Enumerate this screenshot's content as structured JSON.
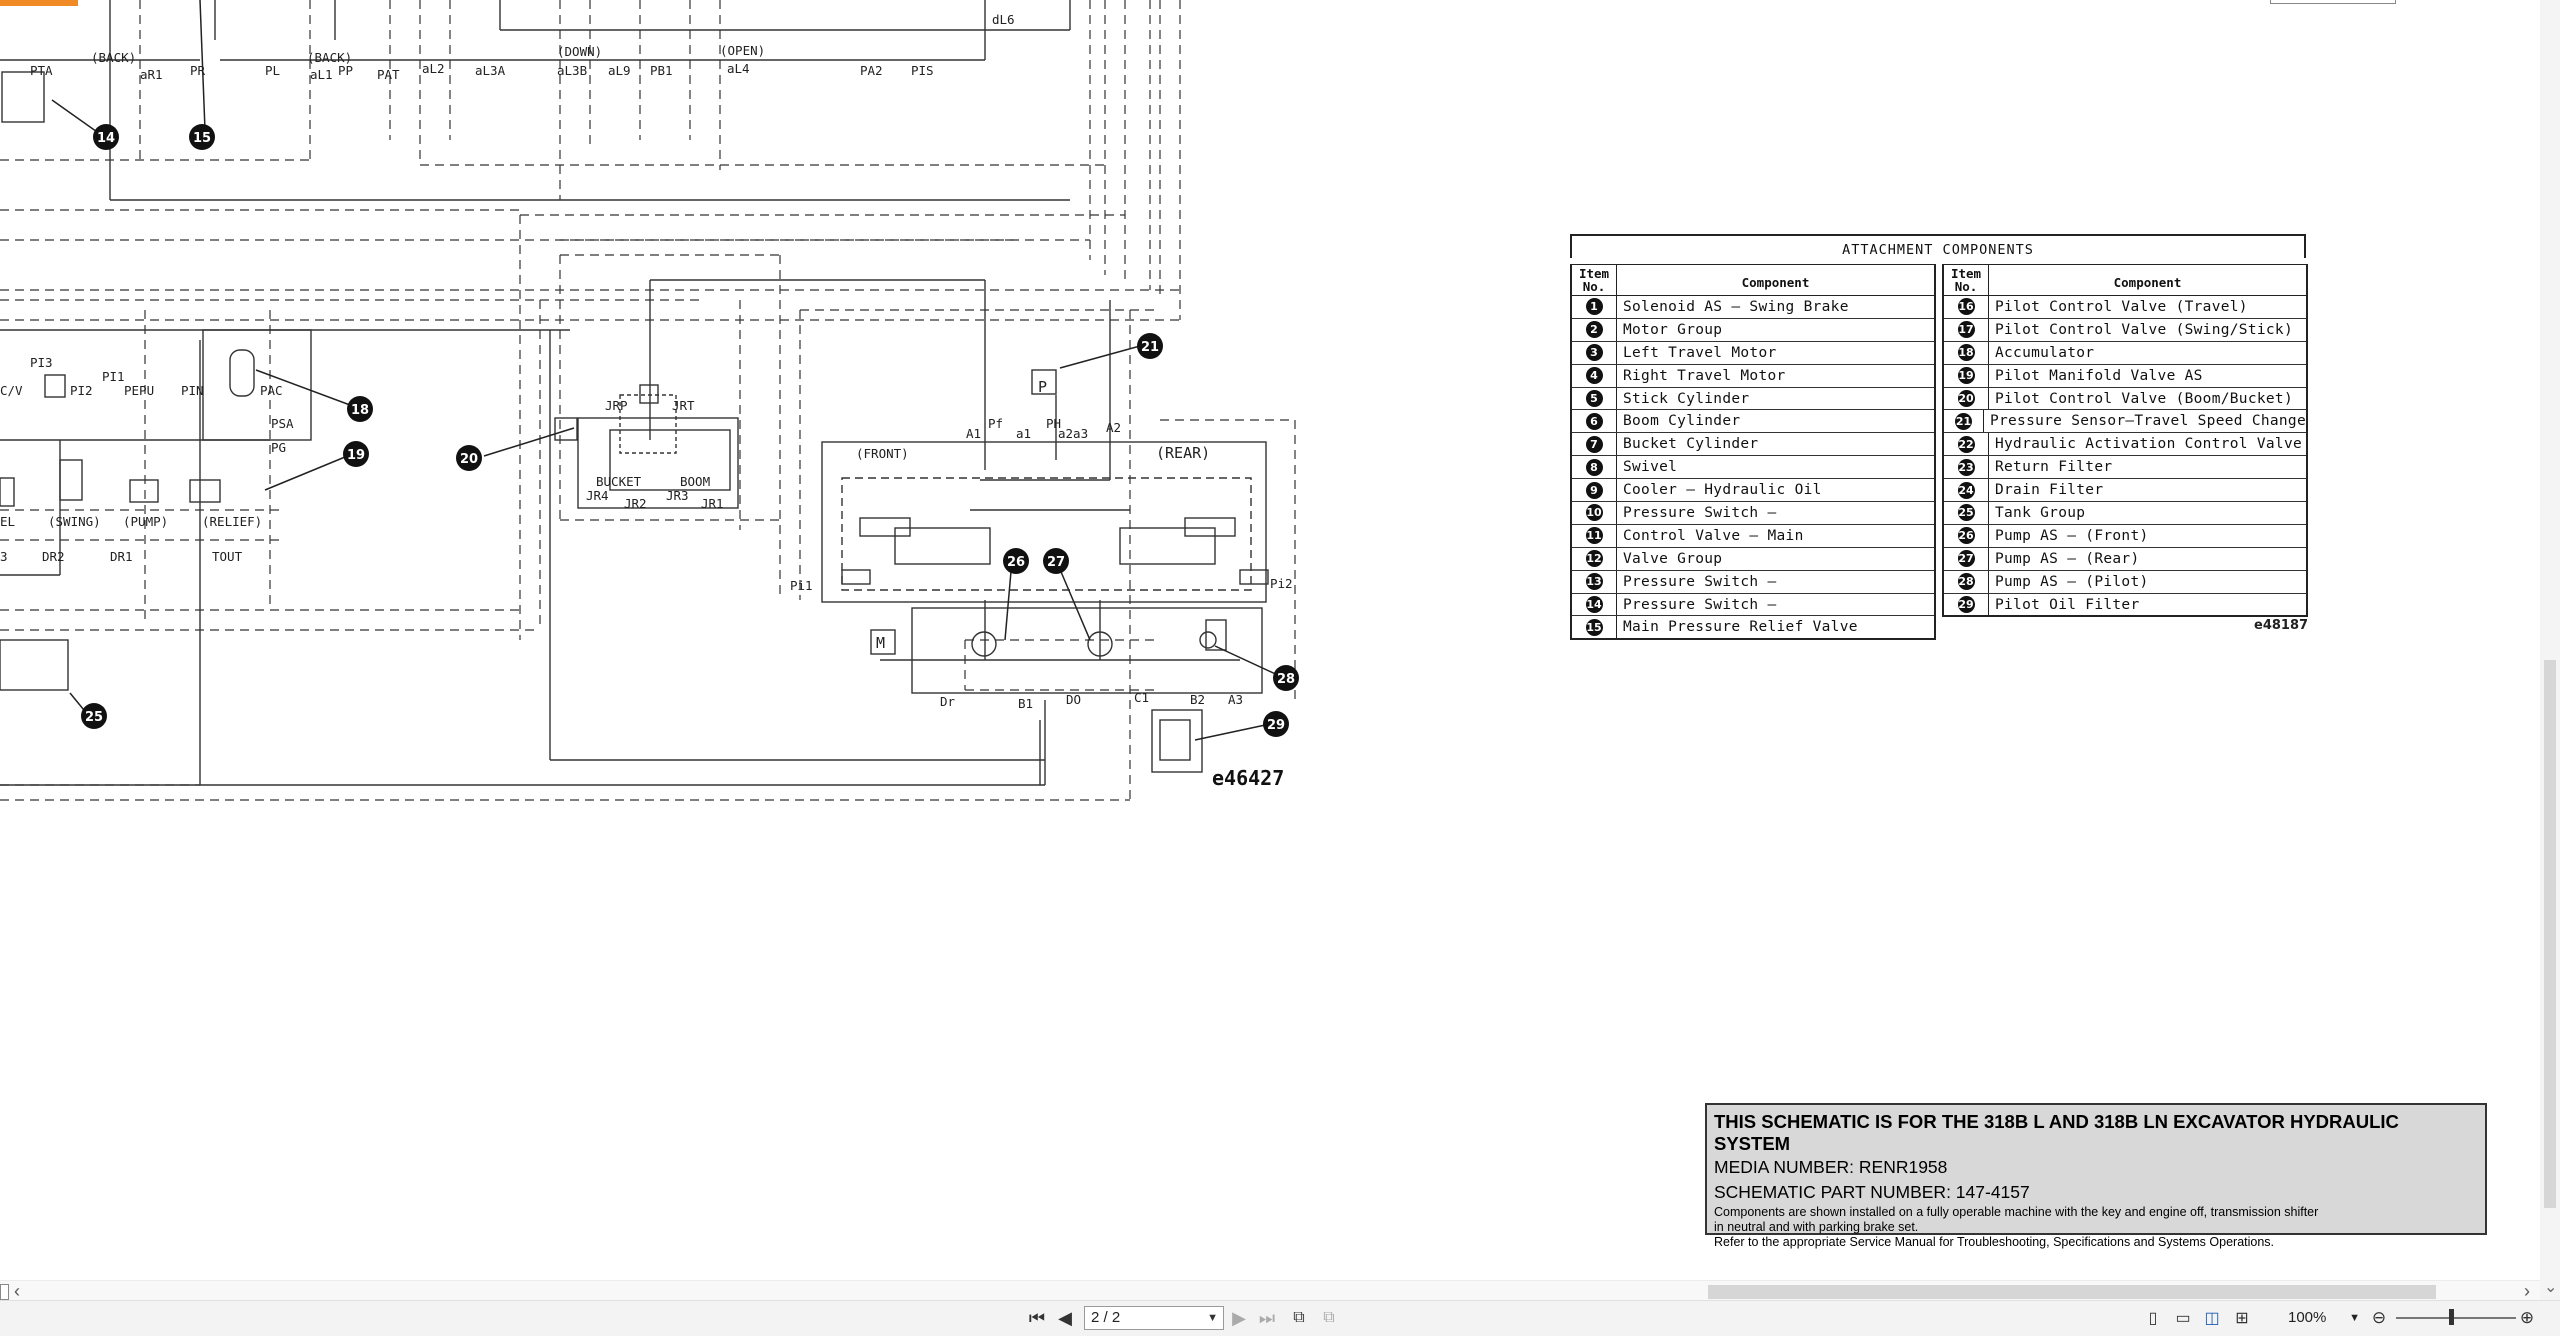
{
  "document": {
    "table_title": "ATTACHMENT  COMPONENTS",
    "header_item": [
      "Item",
      "No."
    ],
    "header_component": "Component",
    "left_items": [
      {
        "no": "1",
        "name": "Solenoid AS – Swing Brake"
      },
      {
        "no": "2",
        "name": "Motor Group"
      },
      {
        "no": "3",
        "name": "Left Travel Motor"
      },
      {
        "no": "4",
        "name": "Right Travel Motor"
      },
      {
        "no": "5",
        "name": "Stick Cylinder"
      },
      {
        "no": "6",
        "name": "Boom Cylinder"
      },
      {
        "no": "7",
        "name": "Bucket Cylinder"
      },
      {
        "no": "8",
        "name": "Swivel"
      },
      {
        "no": "9",
        "name": "Cooler – Hydraulic Oil"
      },
      {
        "no": "10",
        "name": "Pressure Switch –"
      },
      {
        "no": "11",
        "name": "Control Valve – Main"
      },
      {
        "no": "12",
        "name": "Valve Group"
      },
      {
        "no": "13",
        "name": "Pressure Switch –"
      },
      {
        "no": "14",
        "name": "Pressure Switch –"
      },
      {
        "no": "15",
        "name": "Main Pressure Relief Valve"
      }
    ],
    "right_items": [
      {
        "no": "16",
        "name": "Pilot Control Valve (Travel)"
      },
      {
        "no": "17",
        "name": "Pilot Control Valve (Swing/Stick)"
      },
      {
        "no": "18",
        "name": "Accumulator"
      },
      {
        "no": "19",
        "name": "Pilot Manifold Valve AS"
      },
      {
        "no": "20",
        "name": "Pilot Control Valve (Boom/Bucket)"
      },
      {
        "no": "21",
        "name": "Pressure Sensor–Travel Speed Change"
      },
      {
        "no": "22",
        "name": "Hydraulic Activation Control Valve"
      },
      {
        "no": "23",
        "name": "Return Filter"
      },
      {
        "no": "24",
        "name": "Drain Filter"
      },
      {
        "no": "25",
        "name": "Tank Group"
      },
      {
        "no": "26",
        "name": "Pump AS – (Front)"
      },
      {
        "no": "27",
        "name": "Pump AS – (Rear)"
      },
      {
        "no": "28",
        "name": "Pump AS – (Pilot)"
      },
      {
        "no": "29",
        "name": "Pilot Oil Filter"
      }
    ],
    "table_ref": "e48187",
    "schematic_ref": "e46427",
    "notice": {
      "title": "THIS SCHEMATIC IS FOR THE 318B L AND 318B LN EXCAVATOR HYDRAULIC SYSTEM",
      "media": "MEDIA NUMBER: RENR1958",
      "part": "SCHEMATIC PART NUMBER: 147-4157",
      "line1": "Components are shown installed on a fully operable machine with the key and engine off, transmission shifter",
      "line2": "in neutral and with parking brake set.",
      "line3": "Refer to the appropriate Service Manual for Troubleshooting, Specifications and Systems Operations."
    },
    "schematic_labels": {
      "front": "(FRONT)",
      "rear": "(REAR)",
      "back1": "(BACK)",
      "back2": "(BACK)",
      "down": "(DOWN)",
      "open": "(OPEN)",
      "swing": "(SWING)",
      "pump": "(PUMP)",
      "relief": "(RELIEF)",
      "bucket": "BUCKET",
      "boom": "BOOM",
      "pta": "PTA",
      "ar1": "aR1",
      "pr": "PR",
      "pl": "PL",
      "al1": "aL1",
      "pp": "PP",
      "pat": "PAT",
      "al2": "aL2",
      "al3a": "aL3A",
      "al3b": "aL3B",
      "al9": "aL9",
      "pb1": "PB1",
      "al4": "aL4",
      "pa2": "PA2",
      "pis": "PIS",
      "dl6": "dL6",
      "pi3": "PI3",
      "pi1": "PI1",
      "pi2": "PI2",
      "pepu": "PEPU",
      "pin": "PIN",
      "pac": "PAC",
      "psa": "PSA",
      "pg": "PG",
      "cv": "C/V",
      "el": "EL",
      "dr2": "DR2",
      "dr1": "DR1",
      "tout": "TOUT",
      "jrp": "JRP",
      "jrt": "JRT",
      "jr4": "JR4",
      "jr2": "JR2",
      "jr3": "JR3",
      "jr1": "JR1",
      "a1": "A1",
      "pf": "Pf",
      "a1s": "a1",
      "ph": "PH",
      "a2a3": "a2a3",
      "a2": "A2",
      "pi1b": "Pi1",
      "pi2b": "Pi2",
      "dr": "Dr",
      "b1": "B1",
      "do": "DO",
      "c1": "C1",
      "b2": "B2",
      "a3": "A3",
      "p": "P",
      "m": "M",
      "three": "3"
    }
  },
  "viewer": {
    "page_indicator": "2 / 2",
    "zoom": "100%"
  }
}
